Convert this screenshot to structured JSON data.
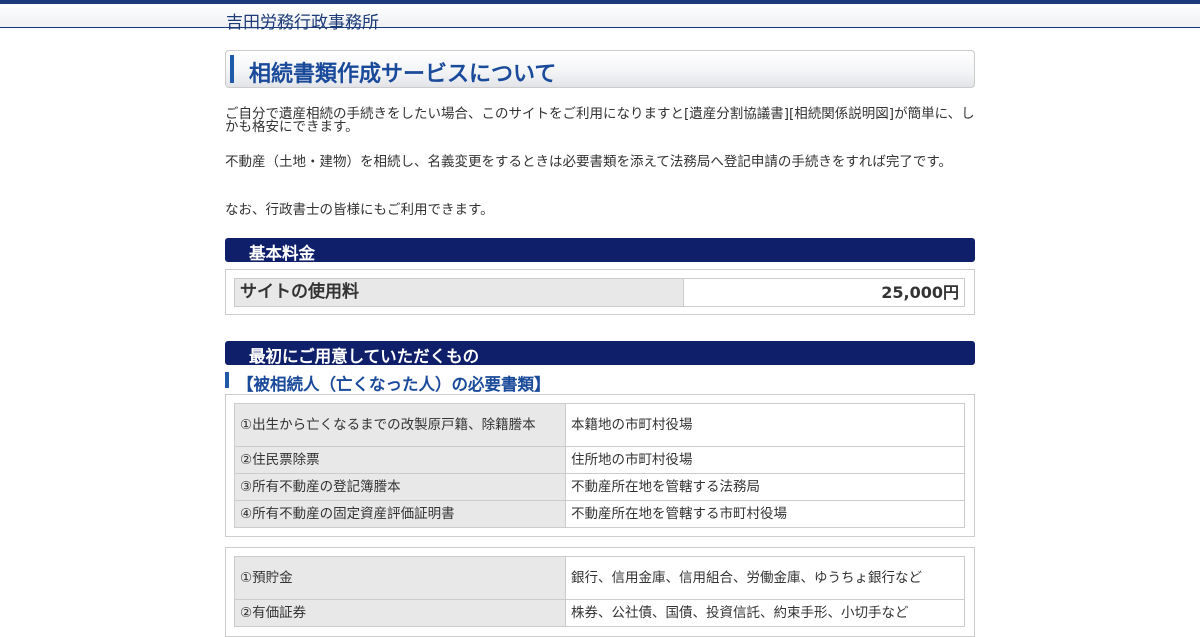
{
  "header": {
    "site_title": "吉田労務行政事務所"
  },
  "page_title": "相続書類作成サービスについて",
  "intro": [
    "ご自分で遺産相続の手続きをしたい場合、このサイトをご利用になりますと[遺産分割協議書][相続関係説明図]が簡単に、しかも格安にできます。",
    "不動産（土地・建物）を相続し、名義変更をするときは必要書類を添えて法務局へ登記申請の手続きをすれば完了です。",
    "なお、行政書士の皆様にもご利用できます。"
  ],
  "fee_section": {
    "title": "基本料金",
    "label": "サイトの使用料",
    "value": "25,000円"
  },
  "prep_section": {
    "title": "最初にご用意していただくもの",
    "subtitle": "【被相続人（亡くなった人）の必要書類】",
    "documents": [
      {
        "item": "①出生から亡くなるまでの改製原戸籍、除籍謄本",
        "where": "本籍地の市町村役場"
      },
      {
        "item": "②住民票除票",
        "where": "住所地の市町村役場"
      },
      {
        "item": "③所有不動産の登記簿謄本",
        "where": "不動産所在地を管轄する法務局"
      },
      {
        "item": "④所有不動産の固定資産評価証明書",
        "where": "不動産所在地を管轄する市町村役場"
      }
    ],
    "assets": [
      {
        "item": "①預貯金",
        "where": "銀行、信用金庫、信用組合、労働金庫、ゆうちょ銀行など"
      },
      {
        "item": "②有価証券",
        "where": "株券、公社債、国債、投資信託、約束手形、小切手など"
      }
    ]
  }
}
